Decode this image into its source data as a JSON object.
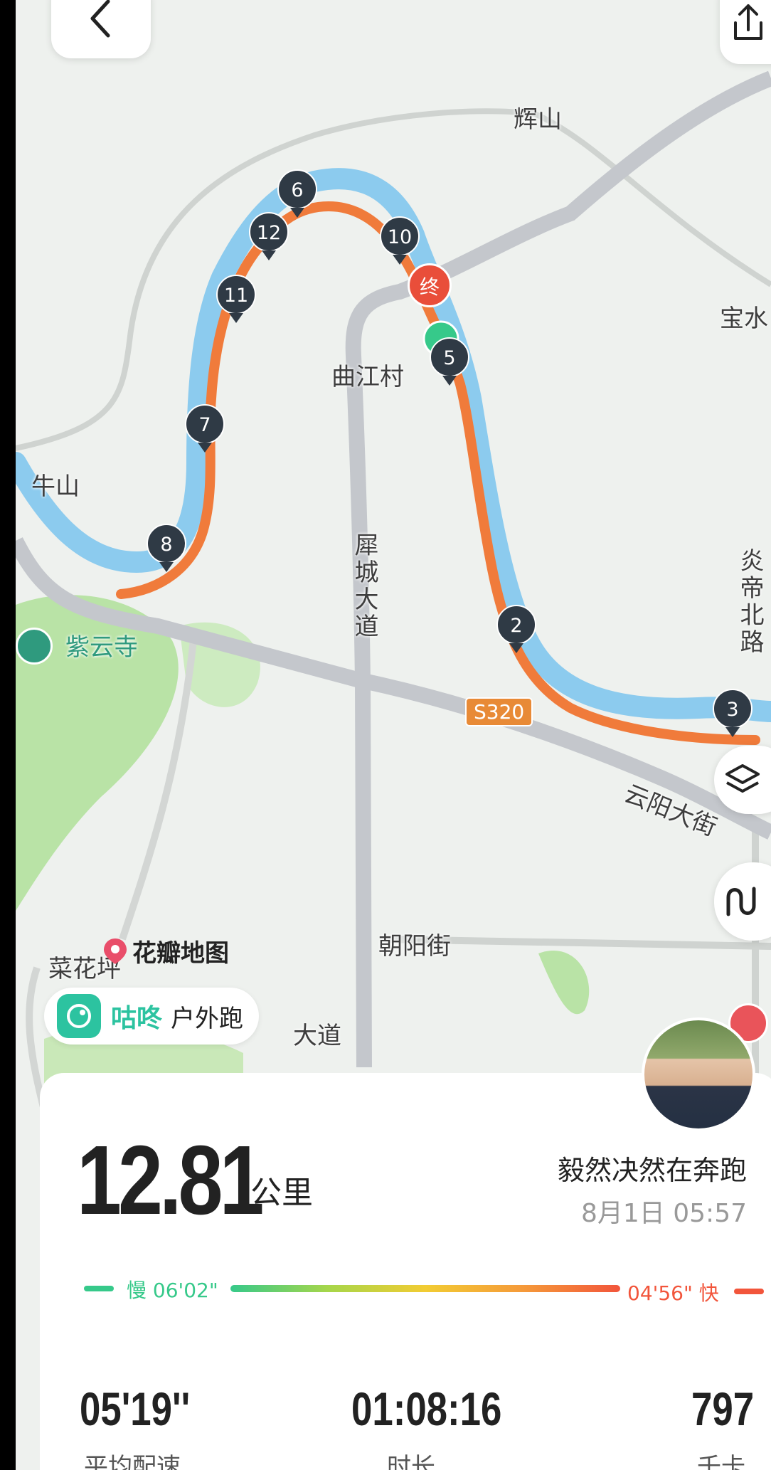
{
  "map": {
    "places": {
      "huishan": "辉山",
      "qujiang": "曲江村",
      "niushan": "牛山",
      "baoshui": "宝水",
      "xicheng": "犀城大道",
      "yandi": "炎帝北路",
      "ziyun": "紫云寺",
      "s320": "S320",
      "yunyang": "云阳大街",
      "chaoyang": "朝阳街",
      "caihua": "菜花坪",
      "dadao": "大道"
    },
    "watermark": "花瓣地图",
    "split_markers": [
      "6",
      "12",
      "10",
      "11",
      "5",
      "7",
      "8",
      "2",
      "3"
    ],
    "end_marker": "终"
  },
  "app_badge": {
    "brand": "咕咚",
    "mode": "户外跑"
  },
  "summary": {
    "distance": "12.81",
    "distance_unit": "公里",
    "user_name": "毅然决然在奔跑",
    "datetime": "8月1日 05:57",
    "pace_slow_label": "慢 06'02\"",
    "pace_fast_label": "04'56\" 快"
  },
  "stats": [
    {
      "value": "05'19''",
      "label": "平均配速"
    },
    {
      "value": "01:08:16",
      "label": "时长"
    },
    {
      "value": "797",
      "label": "千卡"
    }
  ],
  "colors": {
    "route": "#f07b3b",
    "river": "#8ccbee",
    "pin": "#2f3a45",
    "end_pin": "#e94e3a",
    "slow": "#36c98a",
    "fast": "#f2553b"
  },
  "icons": [
    "back-arrow-icon",
    "share-icon",
    "layers-icon",
    "route-mode-icon",
    "location-pin-icon",
    "temple-icon",
    "gudong-logo-icon",
    "hospital-icon"
  ]
}
